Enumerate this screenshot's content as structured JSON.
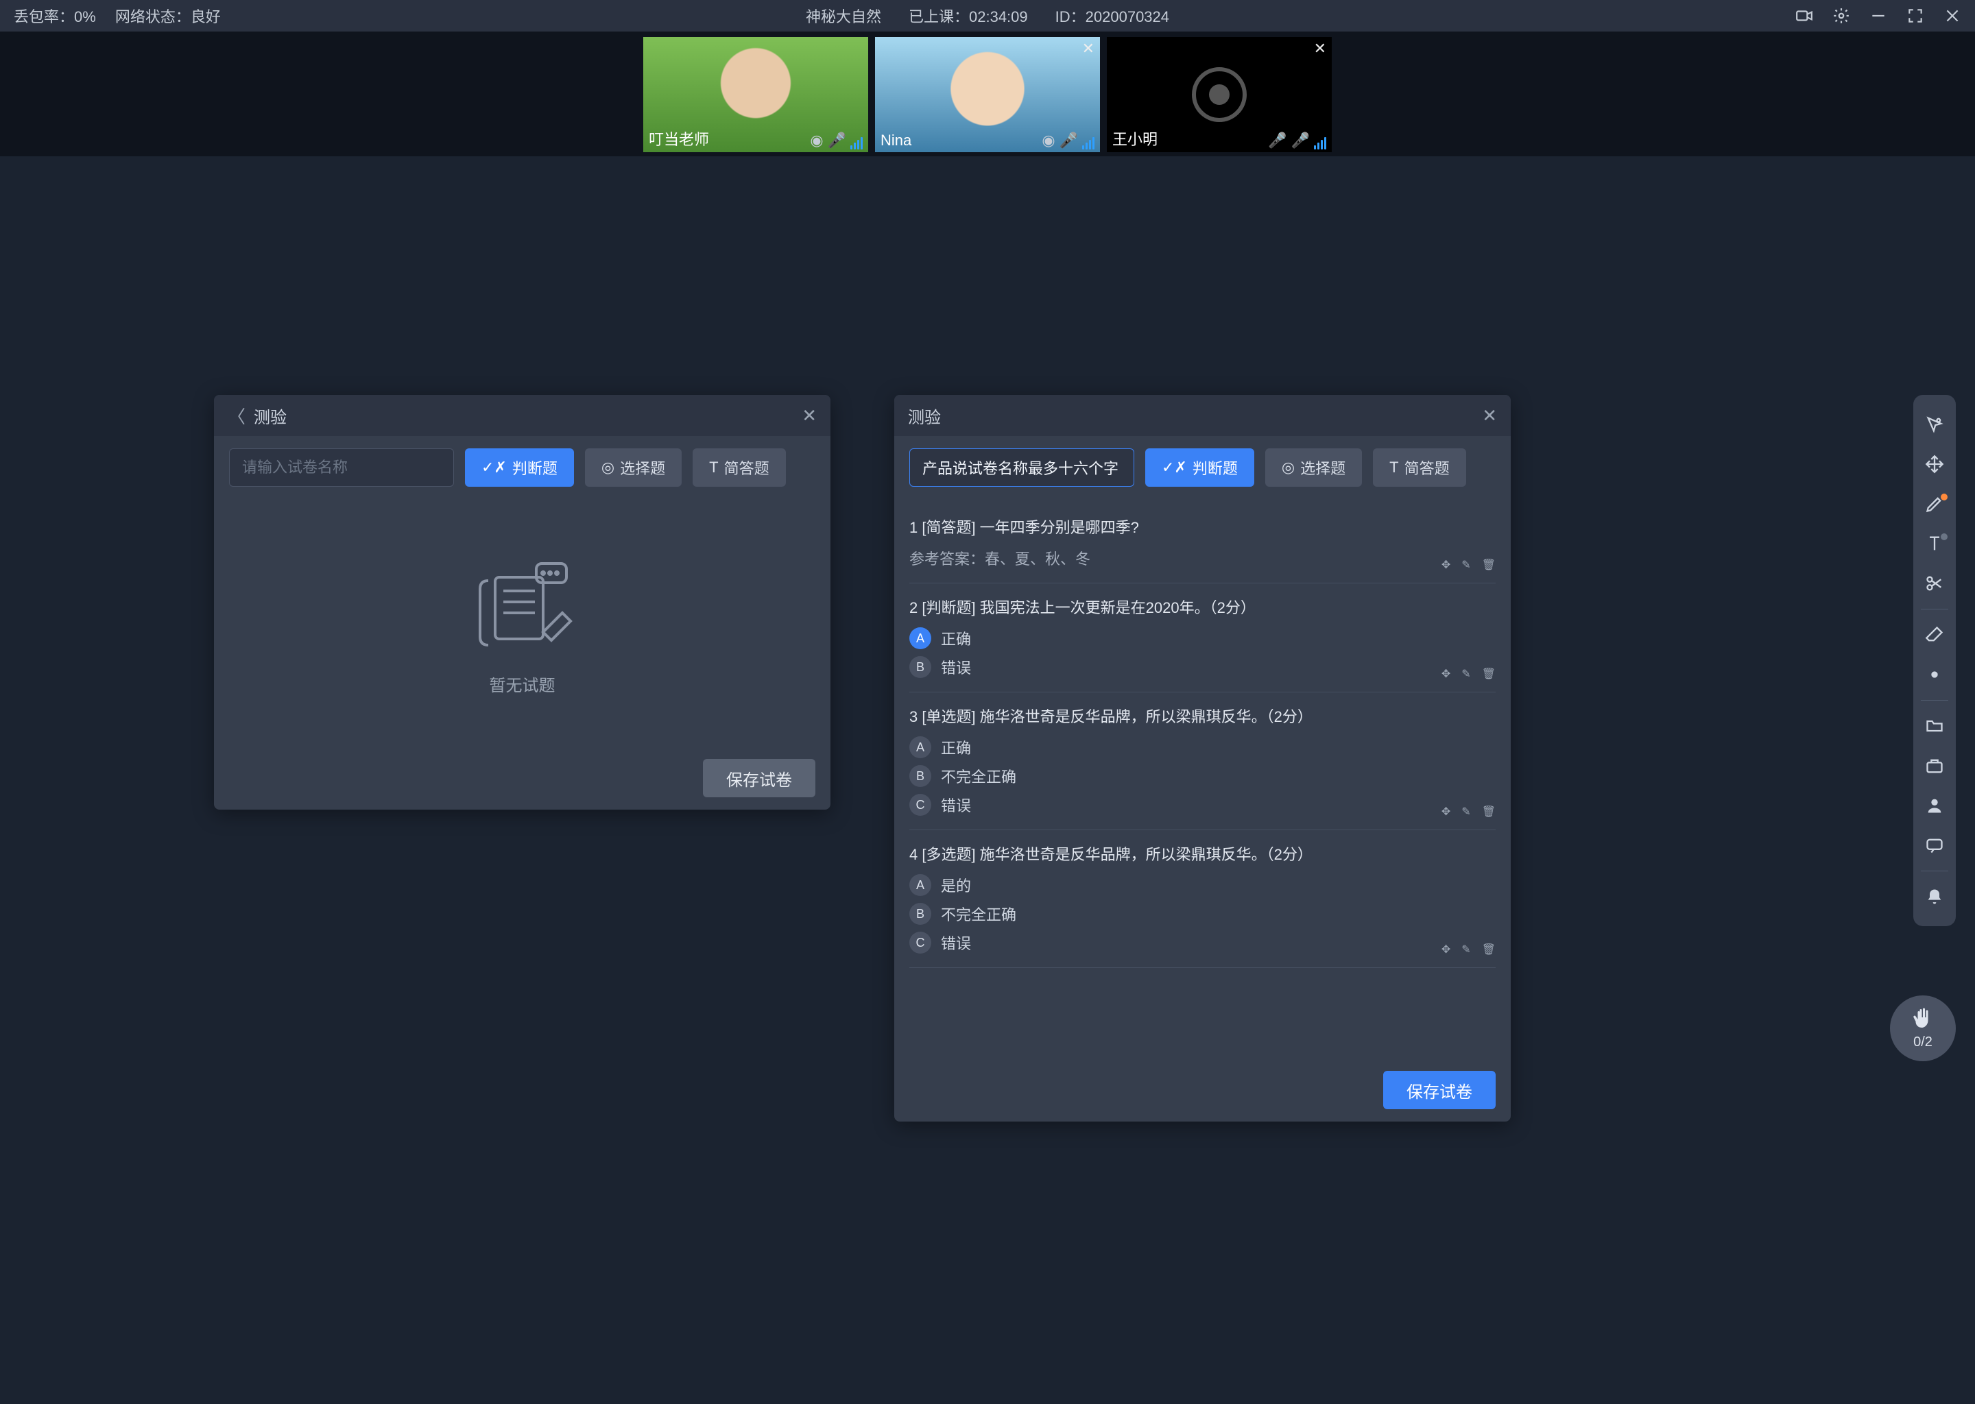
{
  "topbar": {
    "loss_label": "丢包率：",
    "loss_value": "0%",
    "net_label": "网络状态：",
    "net_value": "良好",
    "course_title": "神秘大自然",
    "duration_label": "已上课：",
    "duration_value": "02:34:09",
    "id_label": "ID：",
    "id_value": "2020070324"
  },
  "videos": [
    {
      "name": "叮当老师",
      "has_close": false,
      "muted": false,
      "camera_on": true
    },
    {
      "name": "Nina",
      "has_close": true,
      "muted": false,
      "camera_on": true
    },
    {
      "name": "王小明",
      "has_close": true,
      "muted": true,
      "camera_on": false
    }
  ],
  "panel_left": {
    "title": "测验",
    "input_placeholder": "请输入试卷名称",
    "btn_judge": "判断题",
    "btn_choice": "选择题",
    "btn_short": "简答题",
    "empty_text": "暂无试题",
    "save_btn": "保存试卷"
  },
  "panel_right": {
    "title": "测验",
    "input_value": "产品说试卷名称最多十六个字",
    "btn_judge": "判断题",
    "btn_choice": "选择题",
    "btn_short": "简答题",
    "save_btn": "保存试卷",
    "questions": [
      {
        "num": "1",
        "type": "[简答题]",
        "text": "一年四季分别是哪四季?",
        "answer_label": "参考答案：",
        "answer_value": "春、夏、秋、冬"
      },
      {
        "num": "2",
        "type": "[判断题]",
        "text": "我国宪法上一次更新是在2020年。（2分）",
        "options": [
          {
            "letter": "A",
            "text": "正确",
            "active": true
          },
          {
            "letter": "B",
            "text": "错误",
            "active": false
          }
        ]
      },
      {
        "num": "3",
        "type": "[单选题]",
        "text": "施华洛世奇是反华品牌，所以梁鼎琪反华。（2分）",
        "options": [
          {
            "letter": "A",
            "text": "正确",
            "active": false
          },
          {
            "letter": "B",
            "text": "不完全正确",
            "active": false
          },
          {
            "letter": "C",
            "text": "错误",
            "active": false
          }
        ]
      },
      {
        "num": "4",
        "type": "[多选题]",
        "text": "施华洛世奇是反华品牌，所以梁鼎琪反华。（2分）",
        "options": [
          {
            "letter": "A",
            "text": "是的",
            "active": false
          },
          {
            "letter": "B",
            "text": "不完全正确",
            "active": false
          },
          {
            "letter": "C",
            "text": "错误",
            "active": false
          }
        ]
      }
    ]
  },
  "rail_icons": [
    "pointer",
    "move",
    "pen",
    "text",
    "scissors",
    "eraser",
    "laser",
    "folder",
    "toolbox",
    "user",
    "chat",
    "bell"
  ],
  "hand": {
    "count": "0/2"
  }
}
